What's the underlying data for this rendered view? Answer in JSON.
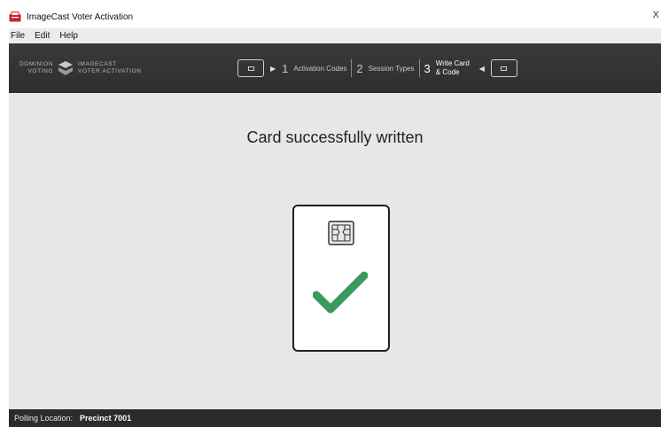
{
  "window": {
    "title": "ImageCast Voter Activation",
    "close_glyph": "X"
  },
  "menu": {
    "items": [
      "File",
      "Edit",
      "Help"
    ]
  },
  "branding": {
    "dominion_line1": "DOMINION",
    "dominion_line2": "VOTING",
    "product_line1": "IMAGECAST",
    "product_line2": "VOTER ACTIVATION"
  },
  "steps": [
    {
      "number": "1",
      "label": "Activation Codes"
    },
    {
      "number": "2",
      "label": "Session Types"
    },
    {
      "number": "3",
      "label": "Write Card & Code",
      "label_line1": "Write Card",
      "label_line2": "& Code",
      "active": true
    }
  ],
  "main": {
    "message": "Card successfully written",
    "icons": {
      "chip": "smartcard-chip-icon",
      "check": "checkmark-icon"
    },
    "check_color": "#3a9a5b"
  },
  "status": {
    "label": "Polling Location:",
    "value": "Precinct 7001"
  },
  "colors": {
    "header_bg": "#333335",
    "content_bg": "#e6e7e9",
    "status_bg": "#2b2b2d",
    "accent_red": "#c8242b"
  }
}
